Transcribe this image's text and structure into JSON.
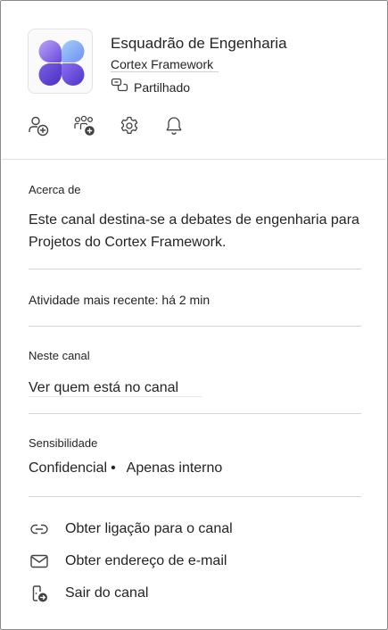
{
  "channel": {
    "name": "Esquadrão de Engenharia",
    "team": "Cortex Framework",
    "shared_label": "Partilhado"
  },
  "action_bar": {
    "icons": [
      "add-member-icon",
      "add-team-icon",
      "settings-icon",
      "notifications-icon"
    ]
  },
  "about": {
    "label": "Acerca de",
    "text_line1": "Este canal destina-se a debates de engenharia para",
    "text_line2": "Projetos do Cortex Framework."
  },
  "activity": {
    "text": "Atividade mais recente: há 2 min"
  },
  "members": {
    "label": "Neste canal",
    "link": "Ver quem está no canal"
  },
  "sensitivity": {
    "label": "Sensibilidade",
    "level": "Confidencial",
    "separator": "•",
    "scope": "Apenas interno"
  },
  "menu": {
    "items": [
      {
        "label": "Obter ligação para o canal",
        "icon": "link-icon"
      },
      {
        "label": "Obter endereço de e-mail",
        "icon": "mail-icon"
      },
      {
        "label": "Sair do canal",
        "icon": "leave-icon"
      }
    ]
  },
  "colors": {
    "logo_gradient_start": "#8fb4f5",
    "logo_gradient_end": "#5b3fd6",
    "border": "#8a8a8a",
    "divider": "#d6d6d6"
  }
}
